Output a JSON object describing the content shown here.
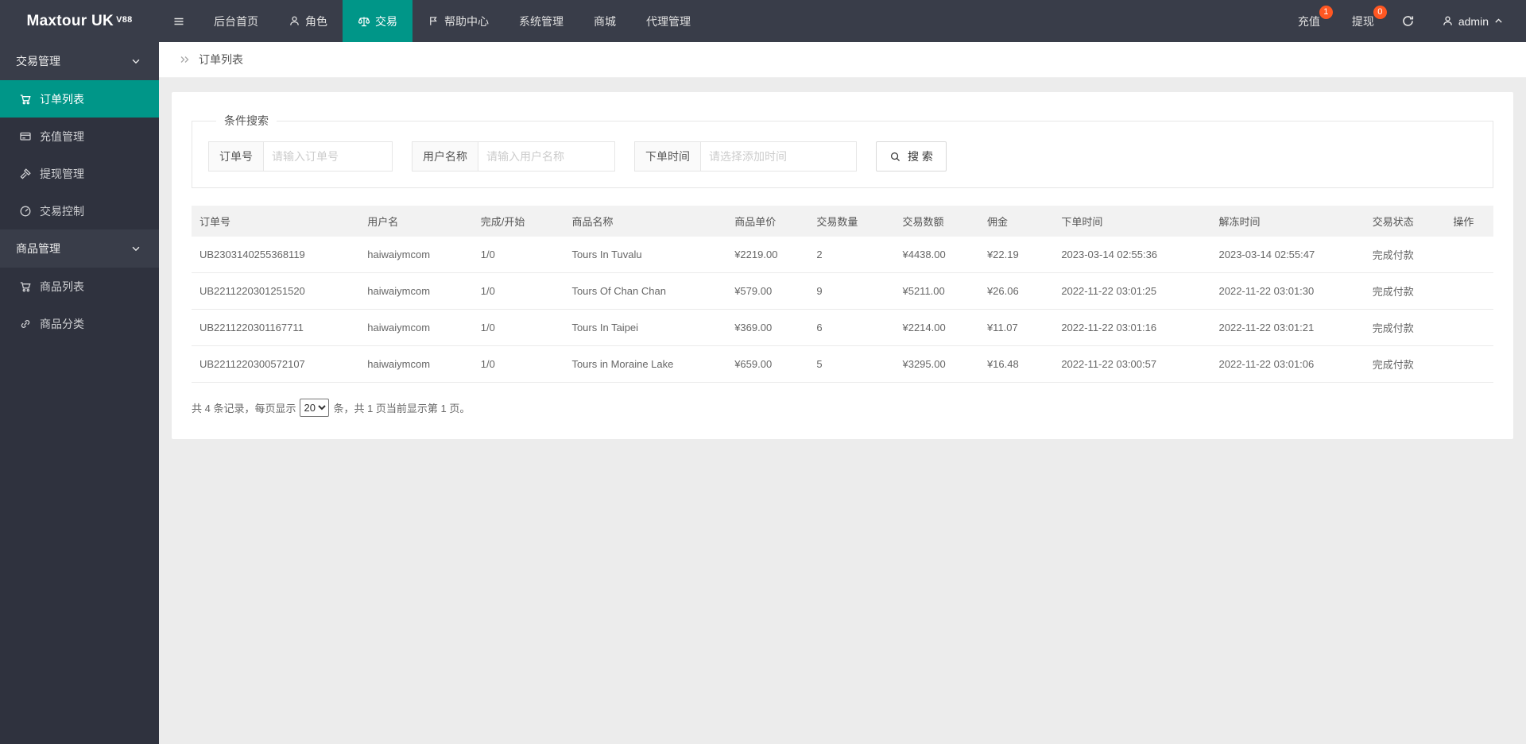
{
  "navbar": {
    "logo": "Maxtour UK",
    "logo_version": "V88",
    "items": [
      {
        "label": "后台首页",
        "icon": null,
        "active": false
      },
      {
        "label": "角色",
        "icon": "person-icon",
        "active": false
      },
      {
        "label": "交易",
        "icon": "scales-icon",
        "active": true
      },
      {
        "label": "帮助中心",
        "icon": "flag-icon",
        "active": false
      },
      {
        "label": "系统管理",
        "icon": null,
        "active": false
      },
      {
        "label": "商城",
        "icon": null,
        "active": false
      },
      {
        "label": "代理管理",
        "icon": null,
        "active": false
      }
    ],
    "recharge": {
      "label": "充值",
      "badge": "1"
    },
    "withdraw": {
      "label": "提现",
      "badge": "0"
    },
    "user": {
      "name": "admin"
    }
  },
  "sidebar": {
    "groups": [
      {
        "label": "交易管理",
        "items": [
          {
            "label": "订单列表",
            "icon": "cart-icon",
            "active": true
          },
          {
            "label": "充值管理",
            "icon": "card-icon",
            "active": false
          },
          {
            "label": "提现管理",
            "icon": "gavel-icon",
            "active": false
          },
          {
            "label": "交易控制",
            "icon": "gauge-icon",
            "active": false
          }
        ]
      },
      {
        "label": "商品管理",
        "items": [
          {
            "label": "商品列表",
            "icon": "cart-icon",
            "active": false
          },
          {
            "label": "商品分类",
            "icon": "link-icon",
            "active": false
          }
        ]
      }
    ]
  },
  "breadcrumb": {
    "title": "订单列表"
  },
  "search": {
    "legend": "条件搜索",
    "fields": [
      {
        "label": "订单号",
        "placeholder": "请输入订单号"
      },
      {
        "label": "用户名称",
        "placeholder": "请输入用户名称"
      },
      {
        "label": "下单时间",
        "placeholder": "请选择添加时间"
      }
    ],
    "button_label": "搜 索"
  },
  "table": {
    "columns": [
      "订单号",
      "用户名",
      "完成/开始",
      "商品名称",
      "商品单价",
      "交易数量",
      "交易数额",
      "佣金",
      "下单时间",
      "解冻时间",
      "交易状态",
      "操作"
    ],
    "rows": [
      [
        "UB2303140255368119",
        "haiwaiymcom",
        "1/0",
        "Tours In Tuvalu",
        "¥2219.00",
        "2",
        "¥4438.00",
        "¥22.19",
        "2023-03-14 02:55:36",
        "2023-03-14 02:55:47",
        "完成付款",
        ""
      ],
      [
        "UB2211220301251520",
        "haiwaiymcom",
        "1/0",
        "Tours Of Chan Chan",
        "¥579.00",
        "9",
        "¥5211.00",
        "¥26.06",
        "2022-11-22 03:01:25",
        "2022-11-22 03:01:30",
        "完成付款",
        ""
      ],
      [
        "UB2211220301167711",
        "haiwaiymcom",
        "1/0",
        "Tours In Taipei",
        "¥369.00",
        "6",
        "¥2214.00",
        "¥11.07",
        "2022-11-22 03:01:16",
        "2022-11-22 03:01:21",
        "完成付款",
        ""
      ],
      [
        "UB2211220300572107",
        "haiwaiymcom",
        "1/0",
        "Tours in Moraine Lake",
        "¥659.00",
        "5",
        "¥3295.00",
        "¥16.48",
        "2022-11-22 03:00:57",
        "2022-11-22 03:01:06",
        "完成付款",
        ""
      ]
    ]
  },
  "pagination": {
    "prefix": "共 4 条记录，每页显示",
    "per_page": "20",
    "suffix": "条，共 1 页当前显示第 1 页。"
  },
  "colors": {
    "accent": "#009688",
    "badge": "#FF5722",
    "navbar": "#393D49",
    "sidebar_child": "#2F323E"
  }
}
